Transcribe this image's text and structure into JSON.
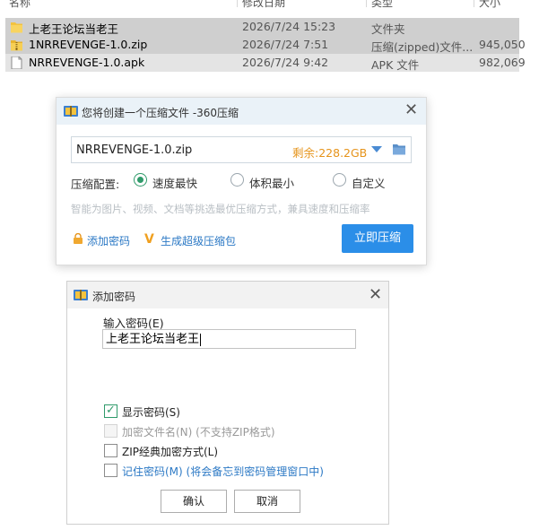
{
  "file_list": {
    "headers": {
      "name": "名称",
      "date": "修改日期",
      "type": "类型",
      "size": "大小"
    },
    "rows": [
      {
        "name": "上老王论坛当老王",
        "date": "2026/7/24 15:23",
        "type": "文件夹",
        "size": ""
      },
      {
        "name": "1NRREVENGE-1.0.zip",
        "date": "2026/7/24 7:51",
        "type": "压缩(zipped)文件...",
        "size": "945,050"
      },
      {
        "name": "NRREVENGE-1.0.apk",
        "date": "2026/7/24 9:42",
        "type": "APK 文件",
        "size": "982,069"
      }
    ]
  },
  "compress_dialog": {
    "title": "您将创建一个压缩文件 -360压缩",
    "filename": "NRREVENGE-1.0.zip",
    "free_space": "剩余:228.2GB",
    "config_label": "压缩配置:",
    "options": [
      "速度最快",
      "体积最小",
      "自定义"
    ],
    "selected_option": "速度最快",
    "hint": "智能为图片、视频、文档等挑选最优压缩方式，兼具速度和压缩率",
    "add_password": "添加密码",
    "super_zip": "生成超级压缩包",
    "compress_button": "立即压缩"
  },
  "password_dialog": {
    "title": "添加密码",
    "input_label": "输入密码(E)",
    "password_value": "上老王论坛当老王",
    "show_password": "显示密码(S)",
    "encrypt_filename": "加密文件名(N) (不支持ZIP格式)",
    "zip_classic": "ZIP经典加密方式(L)",
    "remember_password": "记住密码(M) (将会备忘到密码管理窗口中)",
    "ok": "确认",
    "cancel": "取消"
  },
  "colors": {
    "accent": "#2b8ee8",
    "radio_green": "#2f9a6a",
    "free_space": "#e6941b",
    "link": "#2c79c5"
  }
}
